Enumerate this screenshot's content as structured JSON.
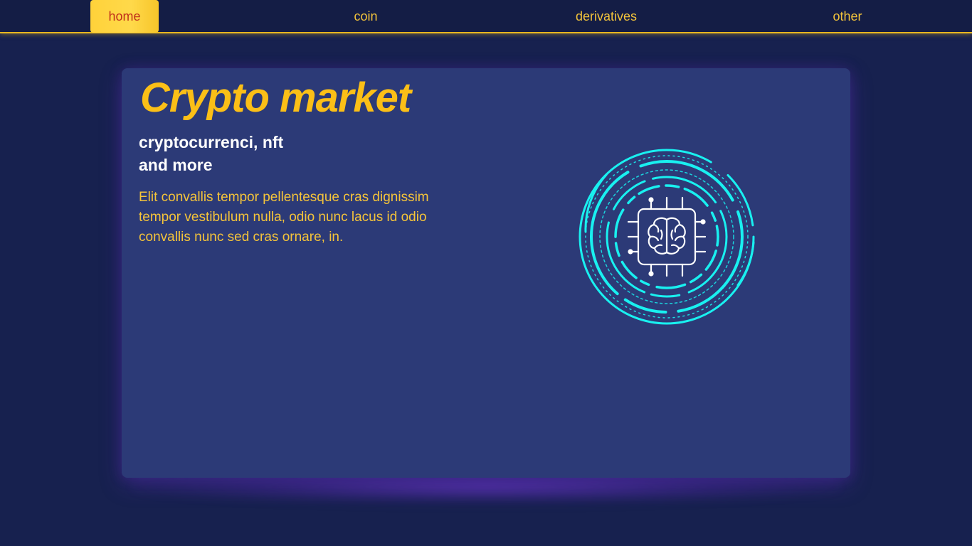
{
  "nav": {
    "items": [
      {
        "label": "home",
        "active": true
      },
      {
        "label": "coin",
        "active": false
      },
      {
        "label": "derivatives",
        "active": false
      },
      {
        "label": "other",
        "active": false
      }
    ]
  },
  "hero": {
    "title": "Crypto market",
    "subtitle_line1": "cryptocurrenci, nft",
    "subtitle_line2": "and more",
    "body": "Elit convallis tempor pellentesque cras dignissim tempor vestibulum nulla, odio nunc lacus id odio convallis nunc sed cras ornare, in.",
    "illustration_icon": "ai-brain-chip-icon"
  },
  "colors": {
    "background": "#17214f",
    "navbar": "#141d45",
    "accent_yellow": "#fbbf17",
    "active_tab_text": "#c0301b",
    "card": "#2c3a77",
    "neon_cyan": "#19f0f0"
  }
}
